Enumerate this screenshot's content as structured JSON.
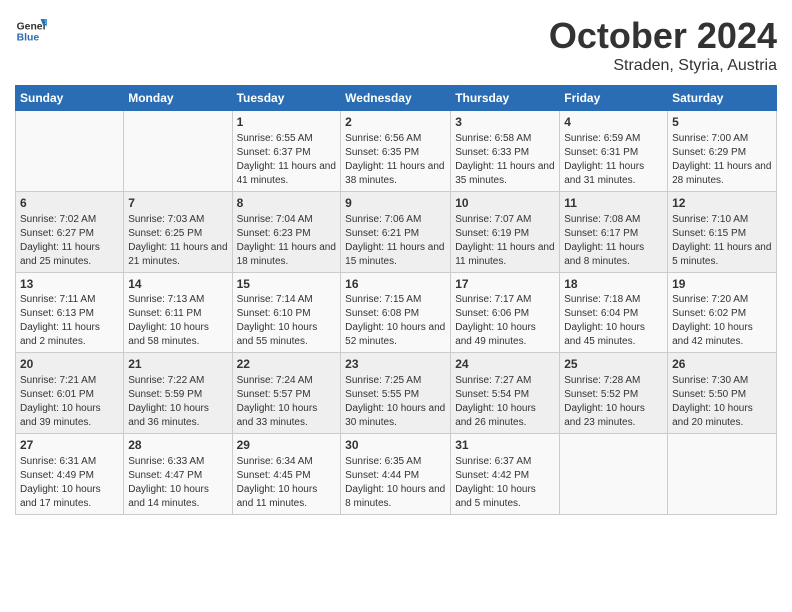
{
  "header": {
    "logo": {
      "general": "General",
      "blue": "Blue"
    },
    "title": "October 2024",
    "subtitle": "Straden, Styria, Austria"
  },
  "calendar": {
    "days_of_week": [
      "Sunday",
      "Monday",
      "Tuesday",
      "Wednesday",
      "Thursday",
      "Friday",
      "Saturday"
    ],
    "weeks": [
      [
        {
          "day": "",
          "info": ""
        },
        {
          "day": "",
          "info": ""
        },
        {
          "day": "1",
          "info": "Sunrise: 6:55 AM\nSunset: 6:37 PM\nDaylight: 11 hours and 41 minutes."
        },
        {
          "day": "2",
          "info": "Sunrise: 6:56 AM\nSunset: 6:35 PM\nDaylight: 11 hours and 38 minutes."
        },
        {
          "day": "3",
          "info": "Sunrise: 6:58 AM\nSunset: 6:33 PM\nDaylight: 11 hours and 35 minutes."
        },
        {
          "day": "4",
          "info": "Sunrise: 6:59 AM\nSunset: 6:31 PM\nDaylight: 11 hours and 31 minutes."
        },
        {
          "day": "5",
          "info": "Sunrise: 7:00 AM\nSunset: 6:29 PM\nDaylight: 11 hours and 28 minutes."
        }
      ],
      [
        {
          "day": "6",
          "info": "Sunrise: 7:02 AM\nSunset: 6:27 PM\nDaylight: 11 hours and 25 minutes."
        },
        {
          "day": "7",
          "info": "Sunrise: 7:03 AM\nSunset: 6:25 PM\nDaylight: 11 hours and 21 minutes."
        },
        {
          "day": "8",
          "info": "Sunrise: 7:04 AM\nSunset: 6:23 PM\nDaylight: 11 hours and 18 minutes."
        },
        {
          "day": "9",
          "info": "Sunrise: 7:06 AM\nSunset: 6:21 PM\nDaylight: 11 hours and 15 minutes."
        },
        {
          "day": "10",
          "info": "Sunrise: 7:07 AM\nSunset: 6:19 PM\nDaylight: 11 hours and 11 minutes."
        },
        {
          "day": "11",
          "info": "Sunrise: 7:08 AM\nSunset: 6:17 PM\nDaylight: 11 hours and 8 minutes."
        },
        {
          "day": "12",
          "info": "Sunrise: 7:10 AM\nSunset: 6:15 PM\nDaylight: 11 hours and 5 minutes."
        }
      ],
      [
        {
          "day": "13",
          "info": "Sunrise: 7:11 AM\nSunset: 6:13 PM\nDaylight: 11 hours and 2 minutes."
        },
        {
          "day": "14",
          "info": "Sunrise: 7:13 AM\nSunset: 6:11 PM\nDaylight: 10 hours and 58 minutes."
        },
        {
          "day": "15",
          "info": "Sunrise: 7:14 AM\nSunset: 6:10 PM\nDaylight: 10 hours and 55 minutes."
        },
        {
          "day": "16",
          "info": "Sunrise: 7:15 AM\nSunset: 6:08 PM\nDaylight: 10 hours and 52 minutes."
        },
        {
          "day": "17",
          "info": "Sunrise: 7:17 AM\nSunset: 6:06 PM\nDaylight: 10 hours and 49 minutes."
        },
        {
          "day": "18",
          "info": "Sunrise: 7:18 AM\nSunset: 6:04 PM\nDaylight: 10 hours and 45 minutes."
        },
        {
          "day": "19",
          "info": "Sunrise: 7:20 AM\nSunset: 6:02 PM\nDaylight: 10 hours and 42 minutes."
        }
      ],
      [
        {
          "day": "20",
          "info": "Sunrise: 7:21 AM\nSunset: 6:01 PM\nDaylight: 10 hours and 39 minutes."
        },
        {
          "day": "21",
          "info": "Sunrise: 7:22 AM\nSunset: 5:59 PM\nDaylight: 10 hours and 36 minutes."
        },
        {
          "day": "22",
          "info": "Sunrise: 7:24 AM\nSunset: 5:57 PM\nDaylight: 10 hours and 33 minutes."
        },
        {
          "day": "23",
          "info": "Sunrise: 7:25 AM\nSunset: 5:55 PM\nDaylight: 10 hours and 30 minutes."
        },
        {
          "day": "24",
          "info": "Sunrise: 7:27 AM\nSunset: 5:54 PM\nDaylight: 10 hours and 26 minutes."
        },
        {
          "day": "25",
          "info": "Sunrise: 7:28 AM\nSunset: 5:52 PM\nDaylight: 10 hours and 23 minutes."
        },
        {
          "day": "26",
          "info": "Sunrise: 7:30 AM\nSunset: 5:50 PM\nDaylight: 10 hours and 20 minutes."
        }
      ],
      [
        {
          "day": "27",
          "info": "Sunrise: 6:31 AM\nSunset: 4:49 PM\nDaylight: 10 hours and 17 minutes."
        },
        {
          "day": "28",
          "info": "Sunrise: 6:33 AM\nSunset: 4:47 PM\nDaylight: 10 hours and 14 minutes."
        },
        {
          "day": "29",
          "info": "Sunrise: 6:34 AM\nSunset: 4:45 PM\nDaylight: 10 hours and 11 minutes."
        },
        {
          "day": "30",
          "info": "Sunrise: 6:35 AM\nSunset: 4:44 PM\nDaylight: 10 hours and 8 minutes."
        },
        {
          "day": "31",
          "info": "Sunrise: 6:37 AM\nSunset: 4:42 PM\nDaylight: 10 hours and 5 minutes."
        },
        {
          "day": "",
          "info": ""
        },
        {
          "day": "",
          "info": ""
        }
      ]
    ]
  }
}
